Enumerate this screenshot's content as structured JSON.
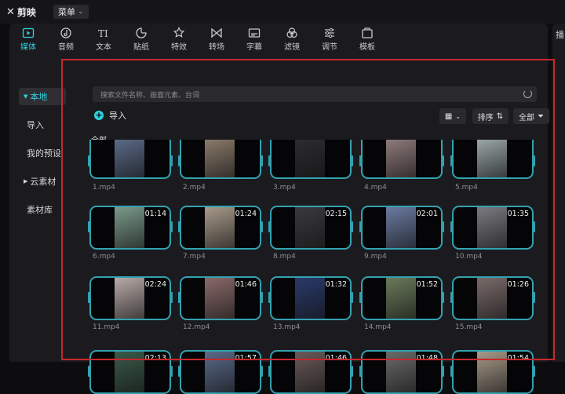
{
  "app": {
    "logo_text": "剪映",
    "menu_label": "菜单",
    "right_panel_hint": "播"
  },
  "toolbar": [
    {
      "label": "媒体",
      "icon": "media-icon",
      "active": true
    },
    {
      "label": "音频",
      "icon": "audio-icon"
    },
    {
      "label": "文本",
      "icon": "text-icon"
    },
    {
      "label": "贴纸",
      "icon": "sticker-icon"
    },
    {
      "label": "特效",
      "icon": "effects-icon"
    },
    {
      "label": "转场",
      "icon": "transition-icon"
    },
    {
      "label": "字幕",
      "icon": "subtitle-icon"
    },
    {
      "label": "滤镜",
      "icon": "filter-icon"
    },
    {
      "label": "调节",
      "icon": "adjust-icon"
    },
    {
      "label": "模板",
      "icon": "template-icon"
    }
  ],
  "sidebar": {
    "local": "本地",
    "import": "导入",
    "presets": "我的预设",
    "cloud": "云素材",
    "library": "素材库"
  },
  "main": {
    "search_placeholder": "搜索文件名称、画面元素、台词",
    "import_label": "导入",
    "sort_label": "排序",
    "filter_label": "全部",
    "section_all": "全部"
  },
  "media": [
    {
      "name": "1.mp4",
      "duration": "",
      "color": "#5a6a86"
    },
    {
      "name": "2.mp4",
      "duration": "",
      "color": "#8a7a6a"
    },
    {
      "name": "3.mp4",
      "duration": "",
      "color": "#2c2c30"
    },
    {
      "name": "4.mp4",
      "duration": "",
      "color": "#8f7a7a"
    },
    {
      "name": "5.mp4",
      "duration": "",
      "color": "#9aa6a6"
    },
    {
      "name": "6.mp4",
      "duration": "01:14",
      "color": "#7a9a8a"
    },
    {
      "name": "7.mp4",
      "duration": "01:24",
      "color": "#a89a8a"
    },
    {
      "name": "8.mp4",
      "duration": "02:15",
      "color": "#3a3a3e"
    },
    {
      "name": "9.mp4",
      "duration": "02:01",
      "color": "#6a7aa0"
    },
    {
      "name": "10.mp4",
      "duration": "01:35",
      "color": "#7a7a80"
    },
    {
      "name": "11.mp4",
      "duration": "02:24",
      "color": "#b8aaa8"
    },
    {
      "name": "12.mp4",
      "duration": "01:46",
      "color": "#8a6a6a"
    },
    {
      "name": "13.mp4",
      "duration": "01:32",
      "color": "#2a3a6a"
    },
    {
      "name": "14.mp4",
      "duration": "01:52",
      "color": "#6a7a5a"
    },
    {
      "name": "15.mp4",
      "duration": "01:26",
      "color": "#7a6a6a"
    },
    {
      "name": "",
      "duration": "02:13",
      "color": "#3a5a4a"
    },
    {
      "name": "",
      "duration": "01:57",
      "color": "#5a6a8a"
    },
    {
      "name": "",
      "duration": "01:46",
      "color": "#6a5a5a"
    },
    {
      "name": "",
      "duration": "01:48",
      "color": "#6a6a6a"
    },
    {
      "name": "",
      "duration": "01:54",
      "color": "#a89a8a"
    }
  ],
  "colors": {
    "accent": "#2fd3e0",
    "card_border": "#33a2b0",
    "highlight_box": "#c8272b"
  }
}
